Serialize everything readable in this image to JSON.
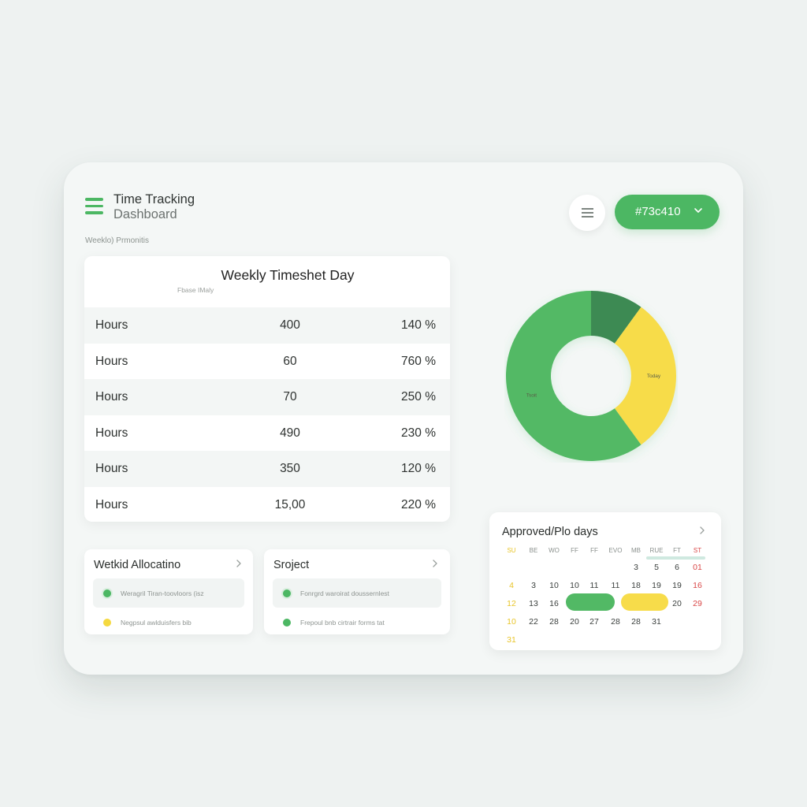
{
  "app": {
    "title_line1": "Time Tracking",
    "title_line2": "Dashboard",
    "subtitle": "Weeklo) Prmonitis",
    "menu_icon": "hamburger-icon"
  },
  "header": {
    "color_value": "#73c410",
    "color_swatch": "#4cb763"
  },
  "timesheet": {
    "title": "Weekly Timeshet Day",
    "subtitle": "Fbase IMaly",
    "rows": [
      {
        "label": "Hours",
        "value": "400",
        "percent": "140 %"
      },
      {
        "label": "Hours",
        "value": "60",
        "percent": "760 %"
      },
      {
        "label": "Hours",
        "value": "70",
        "percent": "250 %"
      },
      {
        "label": "Hours",
        "value": "490",
        "percent": "230 %"
      },
      {
        "label": "Hours",
        "value": "350",
        "percent": "120 %"
      },
      {
        "label": "Hours",
        "value": "15,00",
        "percent": "220 %"
      }
    ]
  },
  "donut": {
    "segments": [
      {
        "label": "",
        "fraction": 0.1,
        "color": "#3d8a52"
      },
      {
        "label": "Today",
        "fraction": 0.3,
        "color": "#f7dc4a"
      },
      {
        "label": "Tsoit",
        "fraction": 0.6,
        "color": "#52b965"
      }
    ]
  },
  "allocation": {
    "title": "Wetkid Allocatino",
    "items": [
      {
        "text": "Weragril Tiran-toovloors (isz",
        "color": "green"
      },
      {
        "text": "Negpsul awlduisfers bib",
        "color": "yellow"
      }
    ]
  },
  "project": {
    "title": "Sroject",
    "items": [
      {
        "text": "Fonrgrd waroirat doussernlest",
        "color": "green"
      },
      {
        "text": "Frepoul bnb cirtrair forms tat",
        "color": "green"
      }
    ]
  },
  "calendar": {
    "title": "Approved/Plo days",
    "headers": [
      "SU",
      "BE",
      "WO",
      "FF",
      "FF",
      "EVO",
      "MB",
      "RUE",
      "FT",
      "ST"
    ],
    "rows": [
      [
        "",
        "",
        "",
        "",
        "",
        "",
        "3",
        "5",
        "6",
        "01"
      ],
      [
        "4",
        "3",
        "10",
        "10",
        "11",
        "11",
        "18",
        "19",
        "19",
        "16"
      ],
      [
        "12",
        "13",
        "16",
        "",
        "",
        "",
        "",
        "",
        "20",
        "29"
      ],
      [
        "10",
        "22",
        "28",
        "20",
        "27",
        "28",
        "28",
        "31",
        "",
        ""
      ],
      [
        "31",
        "",
        "",
        "",
        "",
        "",
        "",
        "",
        "",
        ""
      ]
    ],
    "pills": [
      {
        "color": "#52b965"
      },
      {
        "color": "#f7dc4a"
      }
    ]
  }
}
